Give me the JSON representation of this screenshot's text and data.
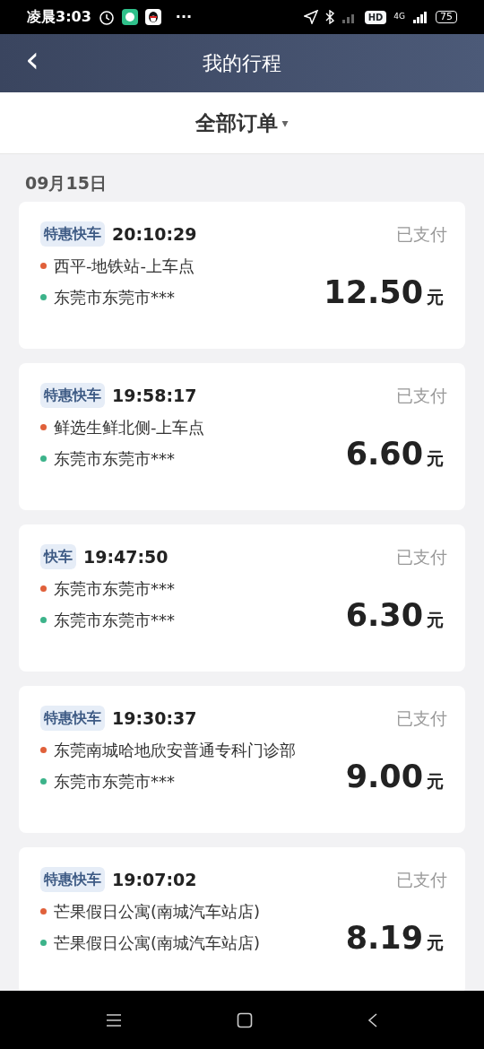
{
  "status_bar": {
    "time": "凌晨3:03",
    "more": "···",
    "hd": "HD",
    "network": "4G",
    "battery": "75"
  },
  "header": {
    "back": "‹",
    "title": "我的行程"
  },
  "filter": {
    "label": "全部订单",
    "caret": "▾"
  },
  "date": "09月15日",
  "orders": [
    {
      "tag": "特惠快车",
      "time": "20:10:29",
      "status": "已支付",
      "stops": [
        {
          "kind": "start",
          "text": "西平-地铁站-上车点"
        },
        {
          "kind": "end",
          "text": "东莞市东莞市***"
        }
      ],
      "price": "12.50",
      "unit": "元"
    },
    {
      "tag": "特惠快车",
      "time": "19:58:17",
      "status": "已支付",
      "stops": [
        {
          "kind": "start",
          "text": "鲜选生鲜北侧-上车点"
        },
        {
          "kind": "end",
          "text": "东莞市东莞市***"
        }
      ],
      "price": "6.60",
      "unit": "元"
    },
    {
      "tag": "快车",
      "time": "19:47:50",
      "status": "已支付",
      "stops": [
        {
          "kind": "start",
          "text": "东莞市东莞市***"
        },
        {
          "kind": "end",
          "text": "东莞市东莞市***"
        }
      ],
      "price": "6.30",
      "unit": "元"
    },
    {
      "tag": "特惠快车",
      "time": "19:30:37",
      "status": "已支付",
      "stops": [
        {
          "kind": "start",
          "text": "东莞南城哈地欣安普通专科门诊部"
        },
        {
          "kind": "end",
          "text": "东莞市东莞市***"
        }
      ],
      "price": "9.00",
      "unit": "元"
    },
    {
      "tag": "特惠快车",
      "time": "19:07:02",
      "status": "已支付",
      "stops": [
        {
          "kind": "start",
          "text": "芒果假日公寓(南城汽车站店)"
        },
        {
          "kind": "end",
          "text": "芒果假日公寓(南城汽车站店)"
        }
      ],
      "price": "8.19",
      "unit": "元"
    }
  ]
}
